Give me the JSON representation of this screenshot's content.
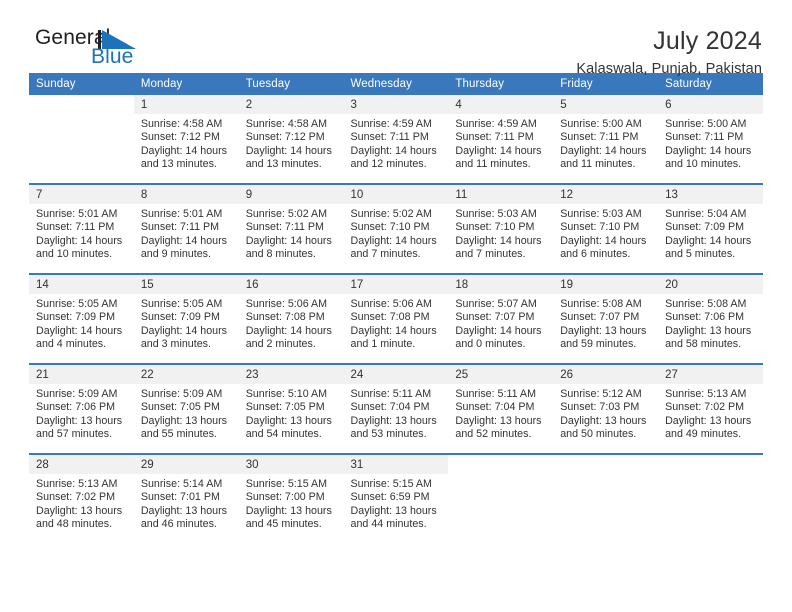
{
  "brand": {
    "name_part1": "General",
    "name_part2": "Blue",
    "logo_icon": "triangle-flag-icon",
    "accent_color": "#1b74bb"
  },
  "header": {
    "title": "July 2024",
    "subtitle": "Kalaswala, Punjab, Pakistan"
  },
  "calendar": {
    "header_bg": "#3978bc",
    "daynum_bg": "#f1f1f1",
    "weekday_headers": [
      "Sunday",
      "Monday",
      "Tuesday",
      "Wednesday",
      "Thursday",
      "Friday",
      "Saturday"
    ],
    "weeks": [
      [
        {
          "day": "",
          "sunrise": "",
          "sunset": "",
          "daylight_line1": "",
          "daylight_line2": ""
        },
        {
          "day": "1",
          "sunrise": "Sunrise: 4:58 AM",
          "sunset": "Sunset: 7:12 PM",
          "daylight_line1": "Daylight: 14 hours",
          "daylight_line2": "and 13 minutes."
        },
        {
          "day": "2",
          "sunrise": "Sunrise: 4:58 AM",
          "sunset": "Sunset: 7:12 PM",
          "daylight_line1": "Daylight: 14 hours",
          "daylight_line2": "and 13 minutes."
        },
        {
          "day": "3",
          "sunrise": "Sunrise: 4:59 AM",
          "sunset": "Sunset: 7:11 PM",
          "daylight_line1": "Daylight: 14 hours",
          "daylight_line2": "and 12 minutes."
        },
        {
          "day": "4",
          "sunrise": "Sunrise: 4:59 AM",
          "sunset": "Sunset: 7:11 PM",
          "daylight_line1": "Daylight: 14 hours",
          "daylight_line2": "and 11 minutes."
        },
        {
          "day": "5",
          "sunrise": "Sunrise: 5:00 AM",
          "sunset": "Sunset: 7:11 PM",
          "daylight_line1": "Daylight: 14 hours",
          "daylight_line2": "and 11 minutes."
        },
        {
          "day": "6",
          "sunrise": "Sunrise: 5:00 AM",
          "sunset": "Sunset: 7:11 PM",
          "daylight_line1": "Daylight: 14 hours",
          "daylight_line2": "and 10 minutes."
        }
      ],
      [
        {
          "day": "7",
          "sunrise": "Sunrise: 5:01 AM",
          "sunset": "Sunset: 7:11 PM",
          "daylight_line1": "Daylight: 14 hours",
          "daylight_line2": "and 10 minutes."
        },
        {
          "day": "8",
          "sunrise": "Sunrise: 5:01 AM",
          "sunset": "Sunset: 7:11 PM",
          "daylight_line1": "Daylight: 14 hours",
          "daylight_line2": "and 9 minutes."
        },
        {
          "day": "9",
          "sunrise": "Sunrise: 5:02 AM",
          "sunset": "Sunset: 7:11 PM",
          "daylight_line1": "Daylight: 14 hours",
          "daylight_line2": "and 8 minutes."
        },
        {
          "day": "10",
          "sunrise": "Sunrise: 5:02 AM",
          "sunset": "Sunset: 7:10 PM",
          "daylight_line1": "Daylight: 14 hours",
          "daylight_line2": "and 7 minutes."
        },
        {
          "day": "11",
          "sunrise": "Sunrise: 5:03 AM",
          "sunset": "Sunset: 7:10 PM",
          "daylight_line1": "Daylight: 14 hours",
          "daylight_line2": "and 7 minutes."
        },
        {
          "day": "12",
          "sunrise": "Sunrise: 5:03 AM",
          "sunset": "Sunset: 7:10 PM",
          "daylight_line1": "Daylight: 14 hours",
          "daylight_line2": "and 6 minutes."
        },
        {
          "day": "13",
          "sunrise": "Sunrise: 5:04 AM",
          "sunset": "Sunset: 7:09 PM",
          "daylight_line1": "Daylight: 14 hours",
          "daylight_line2": "and 5 minutes."
        }
      ],
      [
        {
          "day": "14",
          "sunrise": "Sunrise: 5:05 AM",
          "sunset": "Sunset: 7:09 PM",
          "daylight_line1": "Daylight: 14 hours",
          "daylight_line2": "and 4 minutes."
        },
        {
          "day": "15",
          "sunrise": "Sunrise: 5:05 AM",
          "sunset": "Sunset: 7:09 PM",
          "daylight_line1": "Daylight: 14 hours",
          "daylight_line2": "and 3 minutes."
        },
        {
          "day": "16",
          "sunrise": "Sunrise: 5:06 AM",
          "sunset": "Sunset: 7:08 PM",
          "daylight_line1": "Daylight: 14 hours",
          "daylight_line2": "and 2 minutes."
        },
        {
          "day": "17",
          "sunrise": "Sunrise: 5:06 AM",
          "sunset": "Sunset: 7:08 PM",
          "daylight_line1": "Daylight: 14 hours",
          "daylight_line2": "and 1 minute."
        },
        {
          "day": "18",
          "sunrise": "Sunrise: 5:07 AM",
          "sunset": "Sunset: 7:07 PM",
          "daylight_line1": "Daylight: 14 hours",
          "daylight_line2": "and 0 minutes."
        },
        {
          "day": "19",
          "sunrise": "Sunrise: 5:08 AM",
          "sunset": "Sunset: 7:07 PM",
          "daylight_line1": "Daylight: 13 hours",
          "daylight_line2": "and 59 minutes."
        },
        {
          "day": "20",
          "sunrise": "Sunrise: 5:08 AM",
          "sunset": "Sunset: 7:06 PM",
          "daylight_line1": "Daylight: 13 hours",
          "daylight_line2": "and 58 minutes."
        }
      ],
      [
        {
          "day": "21",
          "sunrise": "Sunrise: 5:09 AM",
          "sunset": "Sunset: 7:06 PM",
          "daylight_line1": "Daylight: 13 hours",
          "daylight_line2": "and 57 minutes."
        },
        {
          "day": "22",
          "sunrise": "Sunrise: 5:09 AM",
          "sunset": "Sunset: 7:05 PM",
          "daylight_line1": "Daylight: 13 hours",
          "daylight_line2": "and 55 minutes."
        },
        {
          "day": "23",
          "sunrise": "Sunrise: 5:10 AM",
          "sunset": "Sunset: 7:05 PM",
          "daylight_line1": "Daylight: 13 hours",
          "daylight_line2": "and 54 minutes."
        },
        {
          "day": "24",
          "sunrise": "Sunrise: 5:11 AM",
          "sunset": "Sunset: 7:04 PM",
          "daylight_line1": "Daylight: 13 hours",
          "daylight_line2": "and 53 minutes."
        },
        {
          "day": "25",
          "sunrise": "Sunrise: 5:11 AM",
          "sunset": "Sunset: 7:04 PM",
          "daylight_line1": "Daylight: 13 hours",
          "daylight_line2": "and 52 minutes."
        },
        {
          "day": "26",
          "sunrise": "Sunrise: 5:12 AM",
          "sunset": "Sunset: 7:03 PM",
          "daylight_line1": "Daylight: 13 hours",
          "daylight_line2": "and 50 minutes."
        },
        {
          "day": "27",
          "sunrise": "Sunrise: 5:13 AM",
          "sunset": "Sunset: 7:02 PM",
          "daylight_line1": "Daylight: 13 hours",
          "daylight_line2": "and 49 minutes."
        }
      ],
      [
        {
          "day": "28",
          "sunrise": "Sunrise: 5:13 AM",
          "sunset": "Sunset: 7:02 PM",
          "daylight_line1": "Daylight: 13 hours",
          "daylight_line2": "and 48 minutes."
        },
        {
          "day": "29",
          "sunrise": "Sunrise: 5:14 AM",
          "sunset": "Sunset: 7:01 PM",
          "daylight_line1": "Daylight: 13 hours",
          "daylight_line2": "and 46 minutes."
        },
        {
          "day": "30",
          "sunrise": "Sunrise: 5:15 AM",
          "sunset": "Sunset: 7:00 PM",
          "daylight_line1": "Daylight: 13 hours",
          "daylight_line2": "and 45 minutes."
        },
        {
          "day": "31",
          "sunrise": "Sunrise: 5:15 AM",
          "sunset": "Sunset: 6:59 PM",
          "daylight_line1": "Daylight: 13 hours",
          "daylight_line2": "and 44 minutes."
        },
        {
          "day": "",
          "sunrise": "",
          "sunset": "",
          "daylight_line1": "",
          "daylight_line2": ""
        },
        {
          "day": "",
          "sunrise": "",
          "sunset": "",
          "daylight_line1": "",
          "daylight_line2": ""
        },
        {
          "day": "",
          "sunrise": "",
          "sunset": "",
          "daylight_line1": "",
          "daylight_line2": ""
        }
      ]
    ]
  }
}
